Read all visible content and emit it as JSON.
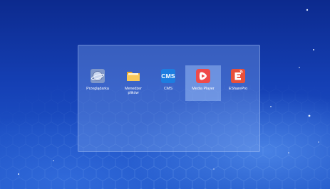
{
  "desktop": {
    "apps": [
      {
        "label_line1": "Przeglądarka",
        "label_line2": "",
        "icon": "browser-planet-icon",
        "selected": false
      },
      {
        "label_line1": "Menedżer",
        "label_line2": "plików",
        "icon": "folder-icon",
        "selected": false
      },
      {
        "label_line1": "CMS",
        "label_line2": "",
        "icon": "cms-icon",
        "icon_text": "CMS",
        "selected": false
      },
      {
        "label_line1": "Media Player",
        "label_line2": "",
        "icon": "media-player-icon",
        "selected": true
      },
      {
        "label_line1": "ESharePro",
        "label_line2": "",
        "icon": "eshare-pro-icon",
        "selected": false
      }
    ]
  },
  "colors": {
    "background_top": "#0c2a8e",
    "background_bottom": "#1f56c8",
    "panel_fill": "#7aa0eb",
    "selection": "#aacdff",
    "cms_blue": "#1e7de0",
    "media_red": "#ef4a4a",
    "eshare_red": "#e8503a",
    "folder_yellow": "#f5c04a"
  }
}
